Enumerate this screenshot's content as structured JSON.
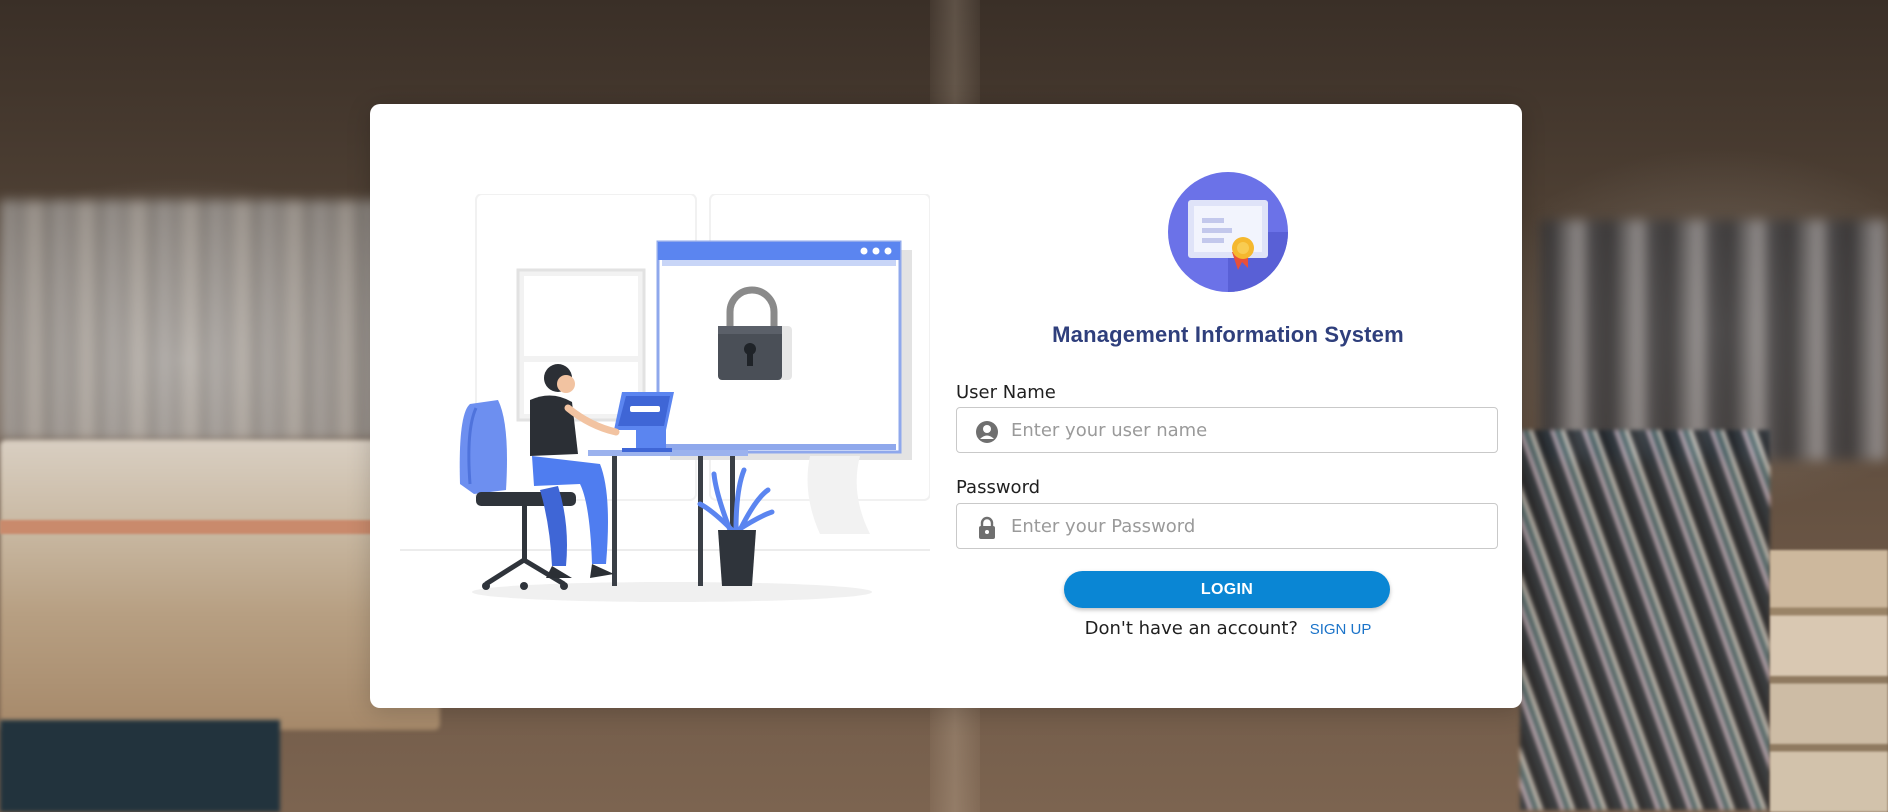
{
  "colors": {
    "title": "#2f3f7c",
    "primary_button": "#0a86d4",
    "link": "#1a73c9",
    "logo_circle": "#6b72e8"
  },
  "app": {
    "title": "Management Information System"
  },
  "form": {
    "username": {
      "label": "User Name",
      "placeholder": "Enter your user name",
      "value": "",
      "icon": "user-circle-icon"
    },
    "password": {
      "label": "Password",
      "placeholder": "Enter your Password",
      "value": "",
      "icon": "lock-icon"
    },
    "login_label": "LOGIN"
  },
  "signup": {
    "prompt": "Don't have an account?",
    "link_label": "SIGN UP"
  }
}
